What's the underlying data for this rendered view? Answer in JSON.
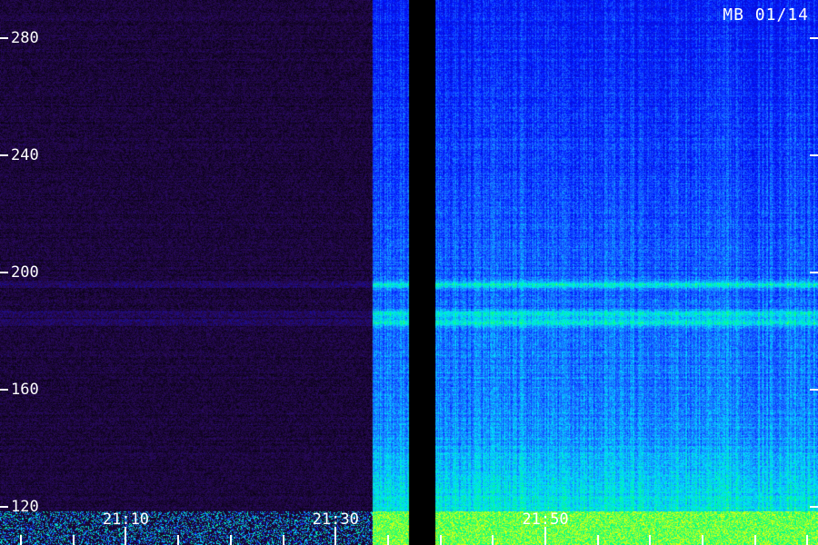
{
  "chart_data": {
    "type": "heatmap",
    "label": "MB 01/14",
    "y_ticks": [
      120,
      160,
      200,
      240,
      280
    ],
    "ylim": [
      107,
      293
    ],
    "x_ticks": [
      "21:10",
      "21:30",
      "21:50"
    ],
    "x_minor_ticks": [
      "21:00",
      "21:05",
      "21:10",
      "21:15",
      "21:20",
      "21:25",
      "21:30",
      "21:35",
      "21:40",
      "21:45",
      "21:50",
      "21:55",
      "22:00",
      "22:05",
      "22:10",
      "22:15"
    ],
    "xlim": [
      "20:58",
      "22:16"
    ],
    "segments": [
      {
        "start": "20:58",
        "end": "21:33.5",
        "level": "very low"
      },
      {
        "start": "21:33.5",
        "end": "21:37",
        "level": "high"
      },
      {
        "start": "21:37",
        "end": "21:39.5",
        "level": "no data"
      },
      {
        "start": "21:39.5",
        "end": "22:16",
        "level": "high"
      }
    ],
    "bright_bands": [
      196,
      186,
      183
    ],
    "colorscale": [
      "#000000",
      "#2a0a5a",
      "#0010ff",
      "#1c6cff",
      "#00e0ff",
      "#00ff80",
      "#ffff00"
    ]
  }
}
